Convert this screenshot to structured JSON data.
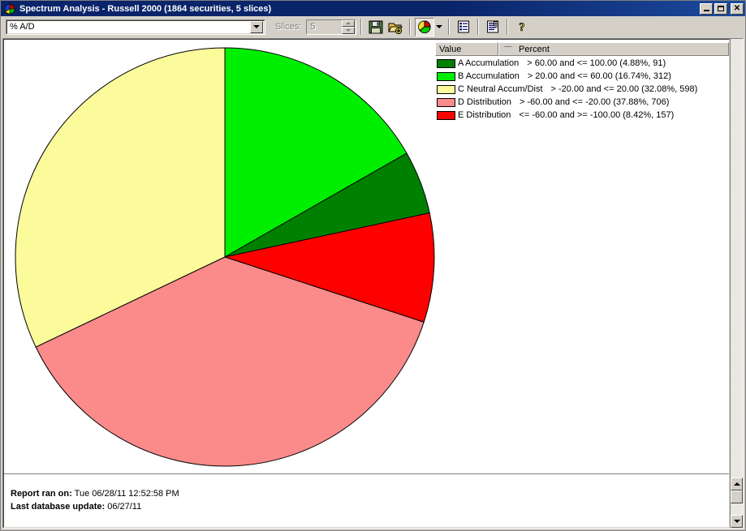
{
  "window": {
    "title": "Spectrum Analysis - Russell 2000 (1864 securities, 5 slices)",
    "icon": "pie-chart-icon",
    "minimize_label": "",
    "maximize_label": "",
    "close_label": "✕"
  },
  "toolbar": {
    "indicator_combo_value": "% A/D",
    "slices_label": "Slices:",
    "slices_value": "5",
    "buttons": [
      {
        "name": "save-button",
        "icon": "floppy-disk-icon"
      },
      {
        "name": "open-add-button",
        "icon": "folder-add-icon"
      },
      {
        "name": "pie-chart-view-button",
        "icon": "pie-chart-icon"
      },
      {
        "name": "chart-type-dropdown-button",
        "icon": "chevron-down-icon"
      },
      {
        "name": "report-view-button",
        "icon": "list-report-icon"
      },
      {
        "name": "detail-report-button",
        "icon": "detail-report-icon"
      },
      {
        "name": "help-button",
        "icon": "question-mark-icon"
      }
    ]
  },
  "legend": {
    "columns": [
      "Value",
      "Percent"
    ],
    "sort_column": "Percent",
    "sort_indicator": "sort-ascending-icon",
    "rows": [
      {
        "color": "#008000",
        "name": "A Accumulation",
        "desc": "> 60.00 and <= 100.00 (4.88%, 91)"
      },
      {
        "color": "#00ee00",
        "name": "B Accumulation",
        "desc": "> 20.00 and <= 60.00 (16.74%, 312)"
      },
      {
        "color": "#fbfb9b",
        "name": "C Neutral Accum/Dist",
        "desc": "> -20.00 and <= 20.00 (32.08%, 598)"
      },
      {
        "color": "#fb8a8a",
        "name": "D Distribution",
        "desc": "> -60.00 and <= -20.00 (37.88%, 706)"
      },
      {
        "color": "#fe0000",
        "name": "E Distribution",
        "desc": "<= -60.00 and >= -100.00 (8.42%, 157)"
      }
    ]
  },
  "chart_data": {
    "type": "pie",
    "title": "Spectrum Analysis - Russell 2000",
    "total_securities": 1864,
    "slice_count": 5,
    "start_angle_deg": 0,
    "direction": "clockwise",
    "center": [
      280,
      327
    ],
    "radius": 258,
    "labels": [
      "B Accumulation",
      "A Accumulation",
      "E Distribution",
      "D Distribution",
      "C Neutral Accum/Dist"
    ],
    "values": [
      16.74,
      4.88,
      8.42,
      37.88,
      32.08
    ],
    "counts": [
      312,
      91,
      157,
      706,
      598
    ],
    "colors": [
      "#00ee00",
      "#008000",
      "#fe0000",
      "#fb8a8a",
      "#fbfb9b"
    ],
    "ranges": [
      "> 20.00 and <= 60.00",
      "> 60.00 and <= 100.00",
      "<= -60.00 and >= -100.00",
      "> -60.00 and <= -20.00",
      "> -20.00 and <= 20.00"
    ],
    "slice_stroke": "#000000",
    "legend_position": "right"
  },
  "footer": {
    "report_ran_label": "Report ran on:",
    "report_ran_value": "Tue 06/28/11 12:52:58 PM",
    "last_update_label": "Last database update:",
    "last_update_value": "06/27/11"
  }
}
